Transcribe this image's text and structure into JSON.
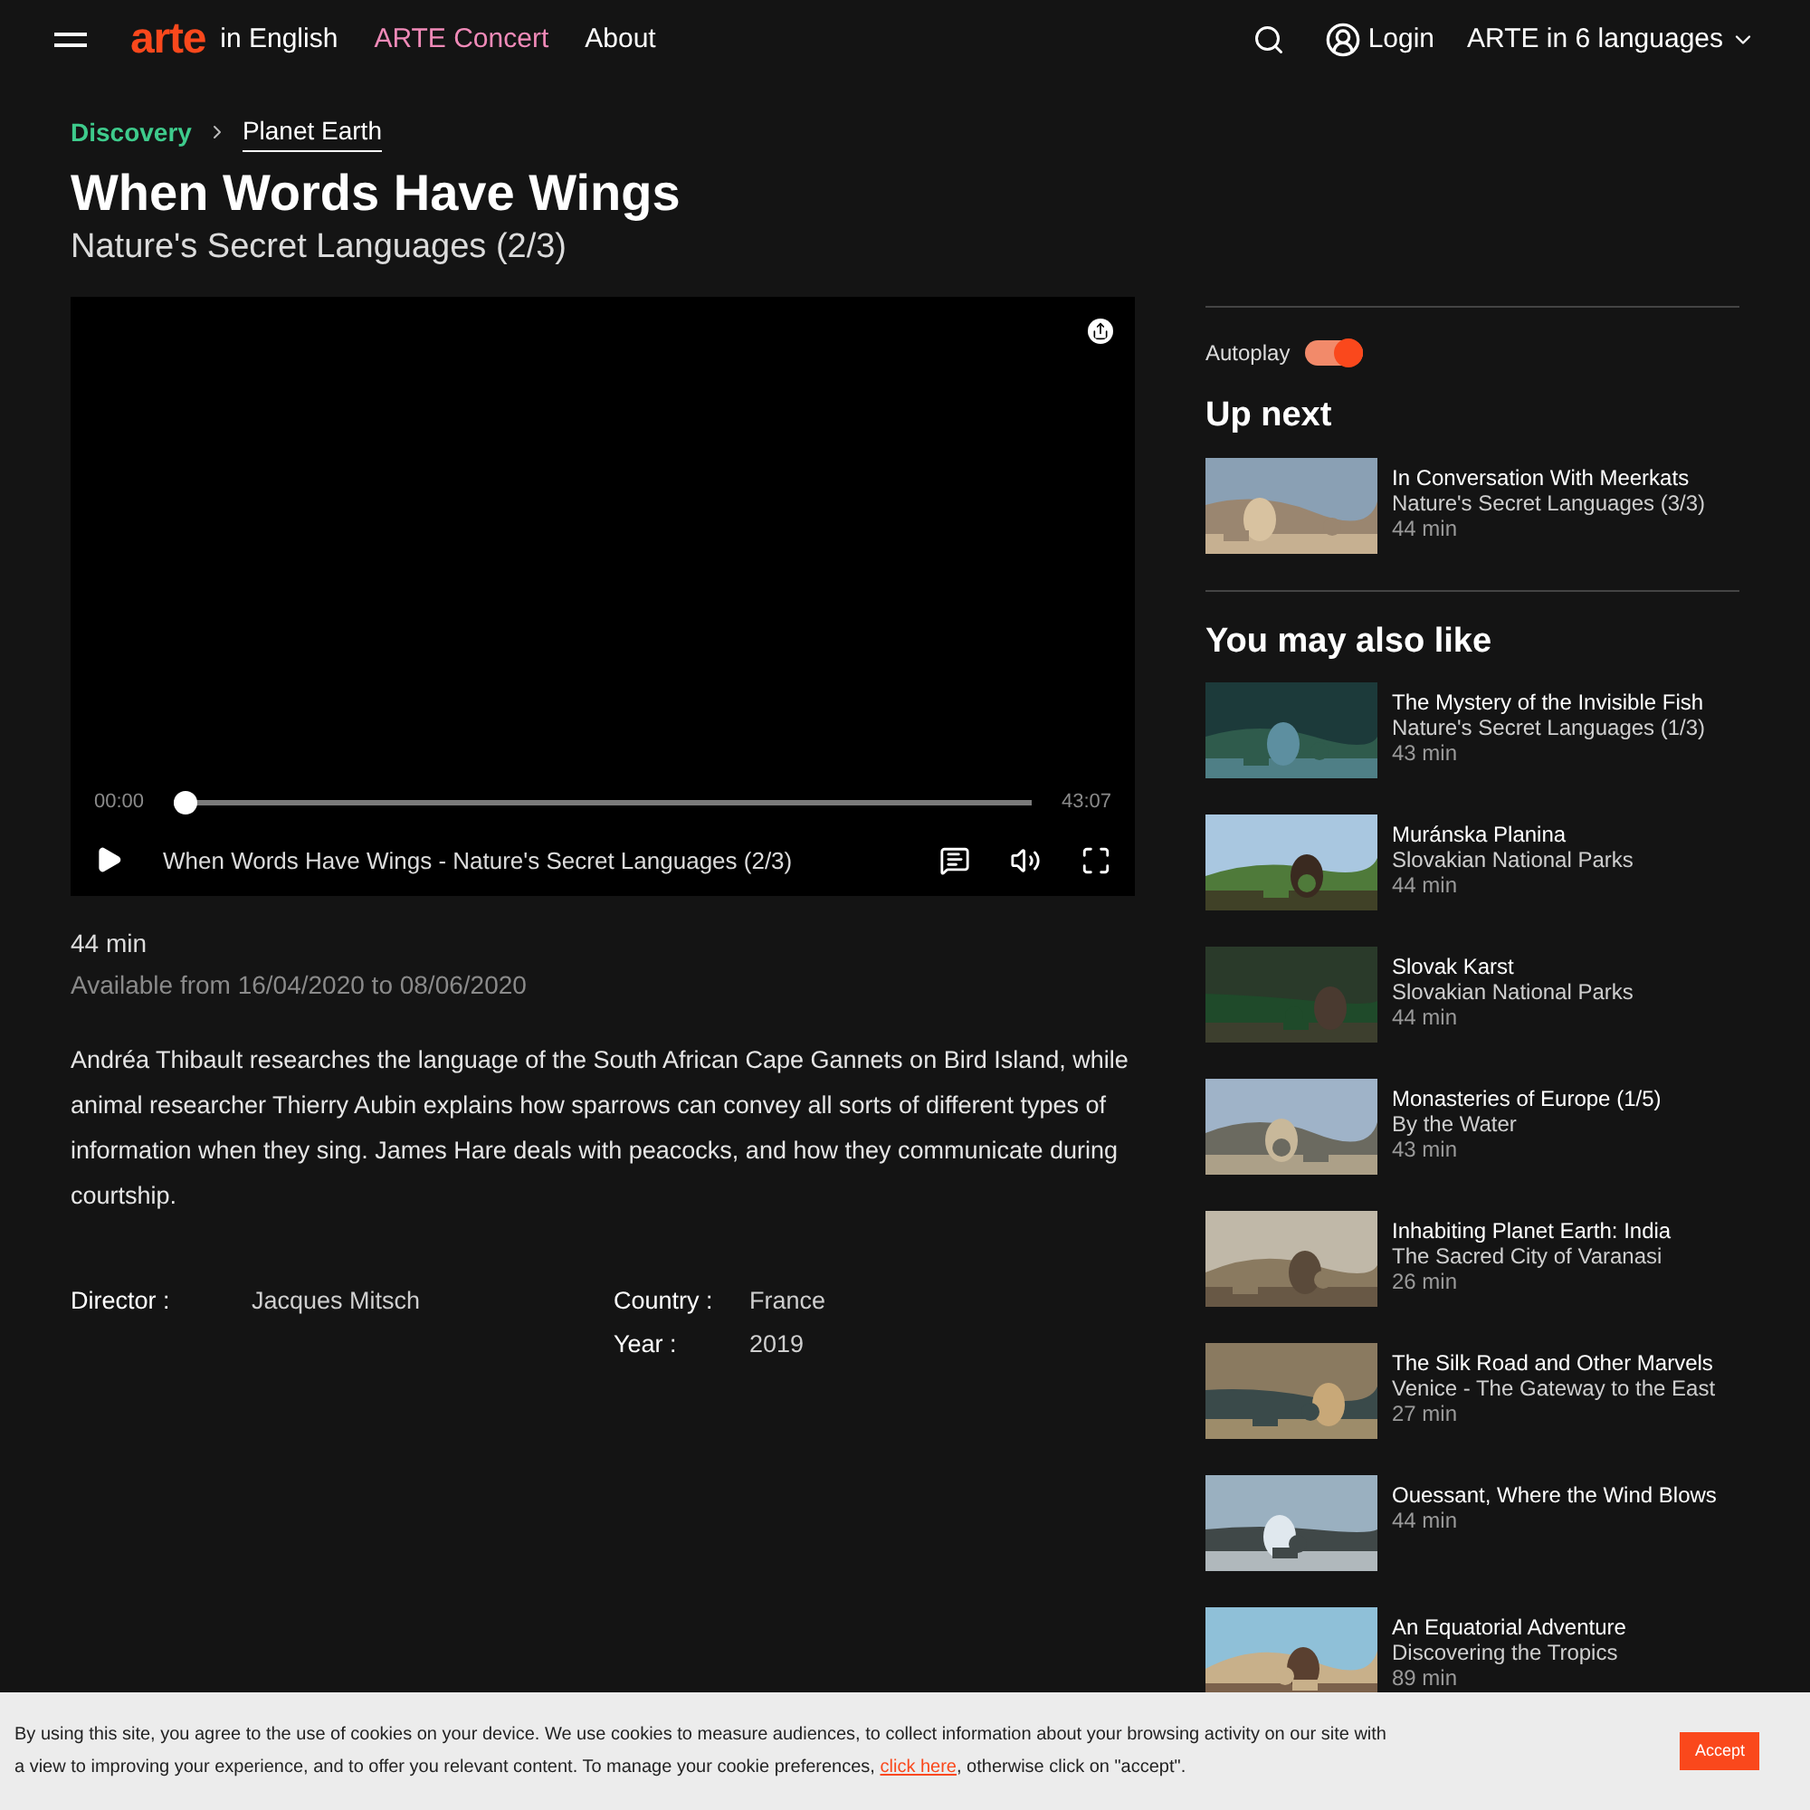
{
  "header": {
    "logo": "arte",
    "edition": "in English",
    "nav": [
      {
        "label": "ARTE Concert",
        "kind": "concert"
      },
      {
        "label": "About",
        "kind": "plain"
      }
    ],
    "login": "Login",
    "languages": "ARTE in 6 languages"
  },
  "breadcrumb": [
    {
      "label": "Discovery",
      "kind": "category"
    },
    {
      "label": "Planet Earth",
      "kind": "link"
    }
  ],
  "title": "When Words Have Wings",
  "subtitle": "Nature's Secret Languages (2/3)",
  "player": {
    "elapsed": "00:00",
    "duration": "43:07",
    "level": 0,
    "caption": "When Words Have Wings - Nature's Secret Languages (2/3)"
  },
  "duration": "44 min",
  "availability": "Available from 16/04/2020 to 08/06/2020",
  "description": "Andréa Thibault researches the language of the South African Cape Gannets on Bird Island, while animal researcher Thierry Aubin explains how sparrows can convey all sorts of different types of information when they sing. James Hare deals with peacocks, and how they communicate during courtship.",
  "credits": [
    {
      "label": "Director :",
      "value": "Jacques Mitsch"
    }
  ],
  "facts": [
    {
      "label": "Country :",
      "value": "France"
    },
    {
      "label": "Year :",
      "value": "2019"
    }
  ],
  "autoplay": {
    "label": "Autoplay",
    "on": true
  },
  "up_next": {
    "heading": "Up next",
    "items": [
      {
        "title": "In Conversation With Meerkats",
        "subtitle": "Nature's Secret Languages (3/3)",
        "duration": "44 min"
      }
    ]
  },
  "also_like": {
    "heading": "You may also like",
    "items": [
      {
        "title": "The Mystery of the Invisible Fish",
        "subtitle": "Nature's Secret Languages (1/3)",
        "duration": "43 min"
      },
      {
        "title": "Muránska Planina",
        "subtitle": "Slovakian National Parks",
        "duration": "44 min"
      },
      {
        "title": "Slovak Karst",
        "subtitle": "Slovakian National Parks",
        "duration": "44 min"
      },
      {
        "title": "Monasteries of Europe (1/5)",
        "subtitle": "By the Water",
        "duration": "43 min"
      },
      {
        "title": "Inhabiting Planet Earth: India",
        "subtitle": "The Sacred City of Varanasi",
        "duration": "26 min"
      },
      {
        "title": "The Silk Road and Other Marvels",
        "subtitle": "Venice - The Gateway to the East",
        "duration": "27 min"
      },
      {
        "title": "Ouessant, Where the Wind Blows",
        "duration": "44 min"
      },
      {
        "title": "An Equatorial Adventure",
        "subtitle": "Discovering the Tropics",
        "duration": "89 min"
      }
    ]
  },
  "cookie_banner": {
    "text_before": "By using this site, you agree to the use of cookies on your device. We use cookies to measure audiences, to collect information about your browsing activity on our site with a view to improving your experience, and to offer you relevant content. To manage your cookie preferences, ",
    "link": "click here",
    "text_after": ", otherwise click on \"accept\".",
    "button": "Accept"
  }
}
